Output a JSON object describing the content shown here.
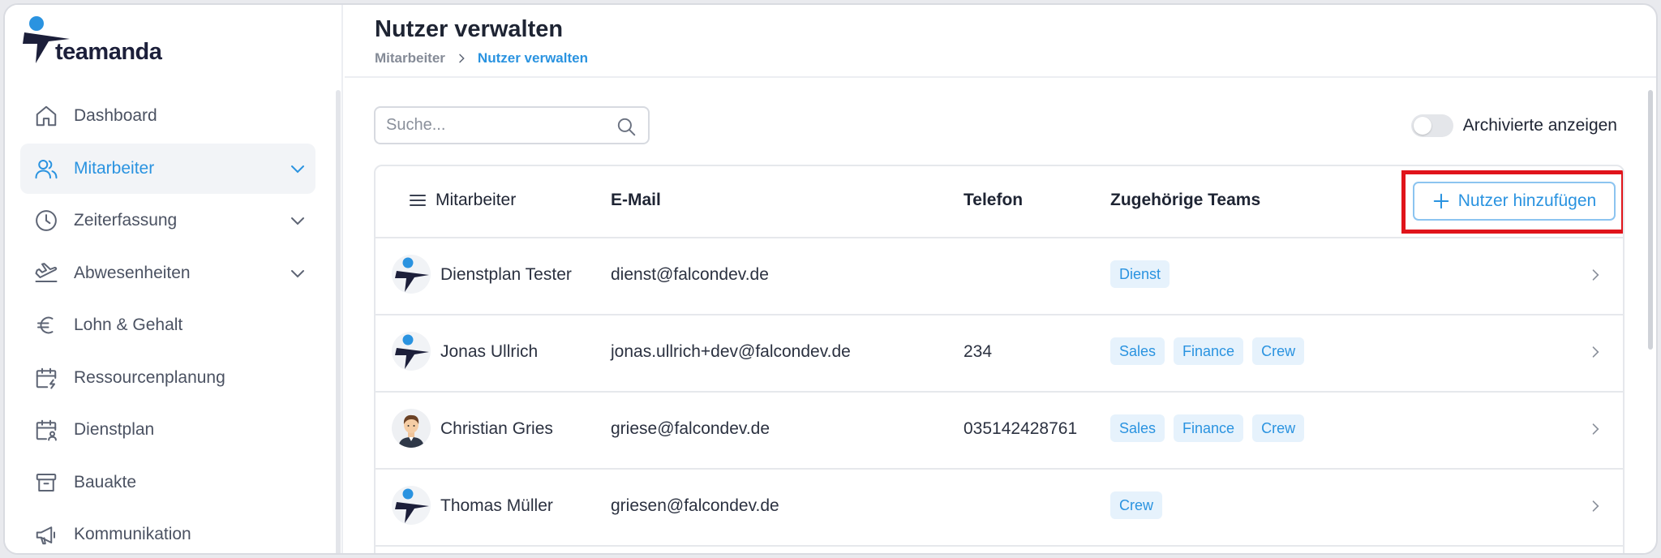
{
  "app": {
    "logo_text": "teamanda",
    "colors": {
      "accent": "#2a93e0",
      "logo_dark": "#1c1f3a",
      "highlight": "#e0141b"
    }
  },
  "sidebar": {
    "items": [
      {
        "label": "Dashboard",
        "icon": "home-icon",
        "active": false,
        "expandable": false
      },
      {
        "label": "Mitarbeiter",
        "icon": "users-icon",
        "active": true,
        "expandable": true
      },
      {
        "label": "Zeiterfassung",
        "icon": "clock-icon",
        "active": false,
        "expandable": true
      },
      {
        "label": "Abwesenheiten",
        "icon": "plane-icon",
        "active": false,
        "expandable": true
      },
      {
        "label": "Lohn & Gehalt",
        "icon": "euro-icon",
        "active": false,
        "expandable": false
      },
      {
        "label": "Ressourcenplanung",
        "icon": "calendar-bolt-icon",
        "active": false,
        "expandable": false
      },
      {
        "label": "Dienstplan",
        "icon": "calendar-user-icon",
        "active": false,
        "expandable": false
      },
      {
        "label": "Bauakte",
        "icon": "archive-icon",
        "active": false,
        "expandable": false
      },
      {
        "label": "Kommunikation",
        "icon": "megaphone-icon",
        "active": false,
        "expandable": false
      }
    ]
  },
  "header": {
    "title": "Nutzer verwalten",
    "breadcrumb": [
      "Mitarbeiter",
      "Nutzer verwalten"
    ]
  },
  "toolbar": {
    "search_placeholder": "Suche...",
    "archived_toggle_label": "Archivierte anzeigen",
    "archived_toggle_on": false
  },
  "table": {
    "columns": [
      "Mitarbeiter",
      "E-Mail",
      "Telefon",
      "Zugehörige Teams"
    ],
    "add_button_label": "Nutzer hinzufügen",
    "rows": [
      {
        "name": "Dienstplan Tester",
        "email": "dienst@falcondev.de",
        "phone": "",
        "teams": [
          "Dienst"
        ],
        "avatar": "logo-avatar"
      },
      {
        "name": "Jonas Ullrich",
        "email": "jonas.ullrich+dev@falcondev.de",
        "phone": "234",
        "teams": [
          "Sales",
          "Finance",
          "Crew"
        ],
        "avatar": "logo-avatar"
      },
      {
        "name": "Christian Gries",
        "email": "griese@falcondev.de",
        "phone": "035142428761",
        "teams": [
          "Sales",
          "Finance",
          "Crew"
        ],
        "avatar": "person-avatar"
      },
      {
        "name": "Thomas Müller",
        "email": "griesen@falcondev.de",
        "phone": "",
        "teams": [
          "Crew"
        ],
        "avatar": "logo-avatar"
      }
    ]
  }
}
